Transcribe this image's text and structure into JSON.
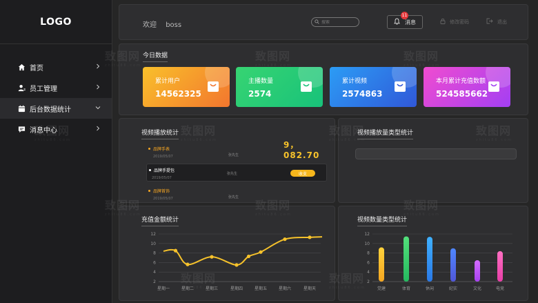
{
  "sidebar": {
    "logo": "LOGO",
    "items": [
      {
        "label": "首页",
        "icon": "home-icon",
        "active": false,
        "chevron": "right"
      },
      {
        "label": "员工管理",
        "icon": "users-icon",
        "active": false,
        "chevron": "right"
      },
      {
        "label": "后台数据统计",
        "icon": "calendar-icon",
        "active": true,
        "chevron": "down"
      },
      {
        "label": "消息中心",
        "icon": "chat-icon",
        "active": false,
        "chevron": "right"
      }
    ]
  },
  "header": {
    "welcome": "欢迎",
    "user": "boss",
    "search_placeholder": "搜索",
    "messages_label": "消息",
    "messages_count": "11",
    "change_password": "修改密码",
    "logout": "退出"
  },
  "today": {
    "title": "今日数据",
    "cards": [
      {
        "label": "累计用户",
        "value": "14562325",
        "from": "#f9c02b",
        "to": "#f2762e"
      },
      {
        "label": "主播数量",
        "value": "2574",
        "from": "#37d472",
        "to": "#18c27a"
      },
      {
        "label": "累计视频",
        "value": "2574863",
        "from": "#2c9cf5",
        "to": "#3058d8"
      },
      {
        "label": "本月累计充值数额",
        "value": "524585662",
        "from": "#f04cd0",
        "to": "#a33ff3"
      }
    ]
  },
  "playback": {
    "title": "视频播放统计",
    "total": "9，082.70",
    "rows": [
      {
        "name": "品牌手表",
        "date": "2019/05/07",
        "who": "张先生",
        "color": "#f6a623",
        "active": false,
        "tag": ""
      },
      {
        "name": "品牌手提包",
        "date": "2019/05/07",
        "who": "张先生",
        "color": "#ffffff",
        "active": true,
        "tag": "收支"
      },
      {
        "name": "品牌首饰",
        "date": "2019/05/07",
        "who": "张先生",
        "color": "#f6a623",
        "active": false,
        "tag": ""
      }
    ]
  },
  "playback_type": {
    "title": "视频播放量类型统计",
    "progress": 0
  },
  "recharge": {
    "title": "充值金额统计"
  },
  "video_types": {
    "title": "视频数量类型统计"
  },
  "chart_data": [
    {
      "type": "line",
      "categories": [
        "星期一",
        "星期二",
        "星期三",
        "星期四",
        "星期五",
        "星期六",
        "星期天"
      ],
      "x": [
        0,
        0.5,
        1,
        2,
        3,
        3.5,
        4,
        5,
        6,
        6.5
      ],
      "values": [
        8.4,
        8.5,
        5.6,
        7.2,
        5.5,
        7.3,
        8.2,
        10.9,
        11.3,
        11.4
      ],
      "ylim": [
        2,
        12
      ],
      "yticks": [
        2,
        4,
        6,
        8,
        10,
        12
      ],
      "color": "#f6c22b",
      "grid": true
    },
    {
      "type": "bar",
      "categories": [
        "党建",
        "体育",
        "休闲",
        "纪实",
        "文化",
        "电竞"
      ],
      "values": [
        9.2,
        11.5,
        11.4,
        9.0,
        6.5,
        8.4
      ],
      "colors": [
        [
          "#ffd23c",
          "#f4a621"
        ],
        [
          "#53e07b",
          "#25b95f"
        ],
        [
          "#3fb1ff",
          "#2a79e6"
        ],
        [
          "#4f87ff",
          "#5057d8"
        ],
        [
          "#d46bff",
          "#a742f0"
        ],
        [
          "#ff6fc2",
          "#e83ea7"
        ]
      ],
      "ylim": [
        2,
        12
      ],
      "yticks": [
        2,
        4,
        6,
        8,
        10,
        12
      ],
      "grid": true
    }
  ]
}
